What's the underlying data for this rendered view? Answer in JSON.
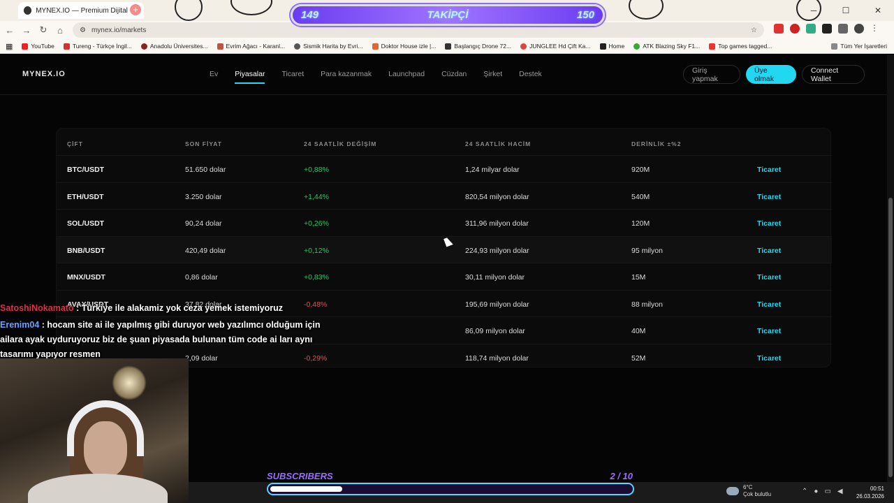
{
  "browser": {
    "tab_title": "MYNEX.IO — Premium Dijital V",
    "url": "mynex.io/markets",
    "bookmarks": [
      "YouTube",
      "Tureng - Türkçe İngil...",
      "Anadolu Üniversites...",
      "Evrim Ağacı - Karanl...",
      "Sismik Harita by Evri...",
      "Doktor House izle |...",
      "Başlangıç Drone 72...",
      "JUNGLEE Hd Çift Ka...",
      "Home",
      "ATK Blazing Sky F1...",
      "Top games tagged..."
    ],
    "all_bookmarks": "Tüm Yer İşaretleri"
  },
  "stream": {
    "follow_left": "149",
    "follow_label": "TAKİPÇİ",
    "follow_right": "150",
    "subs_label": "SUBSCRIBERS",
    "subs_count": "2  / 10",
    "subs_progress": 0.2,
    "chat": [
      {
        "user": "SatoshiNokamato",
        "text": " : Türkiye ile alakamiz yok ceza yemek istemiyoruz"
      },
      {
        "user": "Erenim04",
        "text": " : hocam site ai ile yapılmış gibi duruyor web yazılımcı olduğum için ailara ayak uyduruyoruz biz de şuan piyasada bulunan tüm code ai ları aynı tasarımı yapıyor resmen"
      }
    ]
  },
  "site": {
    "logo": "MYNEX.IO",
    "menu": [
      "Ev",
      "Piyasalar",
      "Ticaret",
      "Para kazanmak",
      "Launchpad",
      "Cüzdan",
      "Şirket",
      "Destek"
    ],
    "active_menu": 1,
    "login": "Giriş yapmak",
    "signup": "Üye olmak",
    "wallet": "Connect Wallet",
    "table": {
      "headers": [
        "ÇİFT",
        "SON FİYAT",
        "24 SAATLİK DEĞİŞİM",
        "24 SAATLİK HACİM",
        "DERİNLİK ±%2"
      ],
      "rows": [
        {
          "pair": "BTC/USDT",
          "price": "51.650 dolar",
          "change": "+0,88%",
          "volume": "1,24 milyar dolar",
          "depth": "920M",
          "action": "Ticaret"
        },
        {
          "pair": "ETH/USDT",
          "price": "3.250 dolar",
          "change": "+1,44%",
          "volume": "820,54 milyon dolar",
          "depth": "540M",
          "action": "Ticaret"
        },
        {
          "pair": "SOL/USDT",
          "price": "90,24 dolar",
          "change": "+0,26%",
          "volume": "311,96 milyon dolar",
          "depth": "120M",
          "action": "Ticaret"
        },
        {
          "pair": "BNB/USDT",
          "price": "420,49 dolar",
          "change": "+0,12%",
          "volume": "224,93 milyon dolar",
          "depth": "95 milyon",
          "action": "Ticaret"
        },
        {
          "pair": "MNX/USDT",
          "price": "0,86 dolar",
          "change": "+0,83%",
          "volume": "30,11 milyon dolar",
          "depth": "15M",
          "action": "Ticaret"
        },
        {
          "pair": "AVAX/USDT",
          "price": "37,82 dolar",
          "change": "-0,48%",
          "volume": "195,69 milyon dolar",
          "depth": "88 milyon",
          "action": "Ticaret"
        },
        {
          "pair": "",
          "price": "",
          "change": "",
          "volume": "86,09 milyon dolar",
          "depth": "40M",
          "action": "Ticaret"
        },
        {
          "pair": "",
          "price": "2,09 dolar",
          "change": "-0,29%",
          "volume": "118,74 milyon dolar",
          "depth": "52M",
          "action": "Ticaret"
        }
      ]
    }
  },
  "taskbar": {
    "temp": "6°C",
    "weather": "Çok bulutlu",
    "time": "00:51",
    "date": "26.03.2026"
  }
}
